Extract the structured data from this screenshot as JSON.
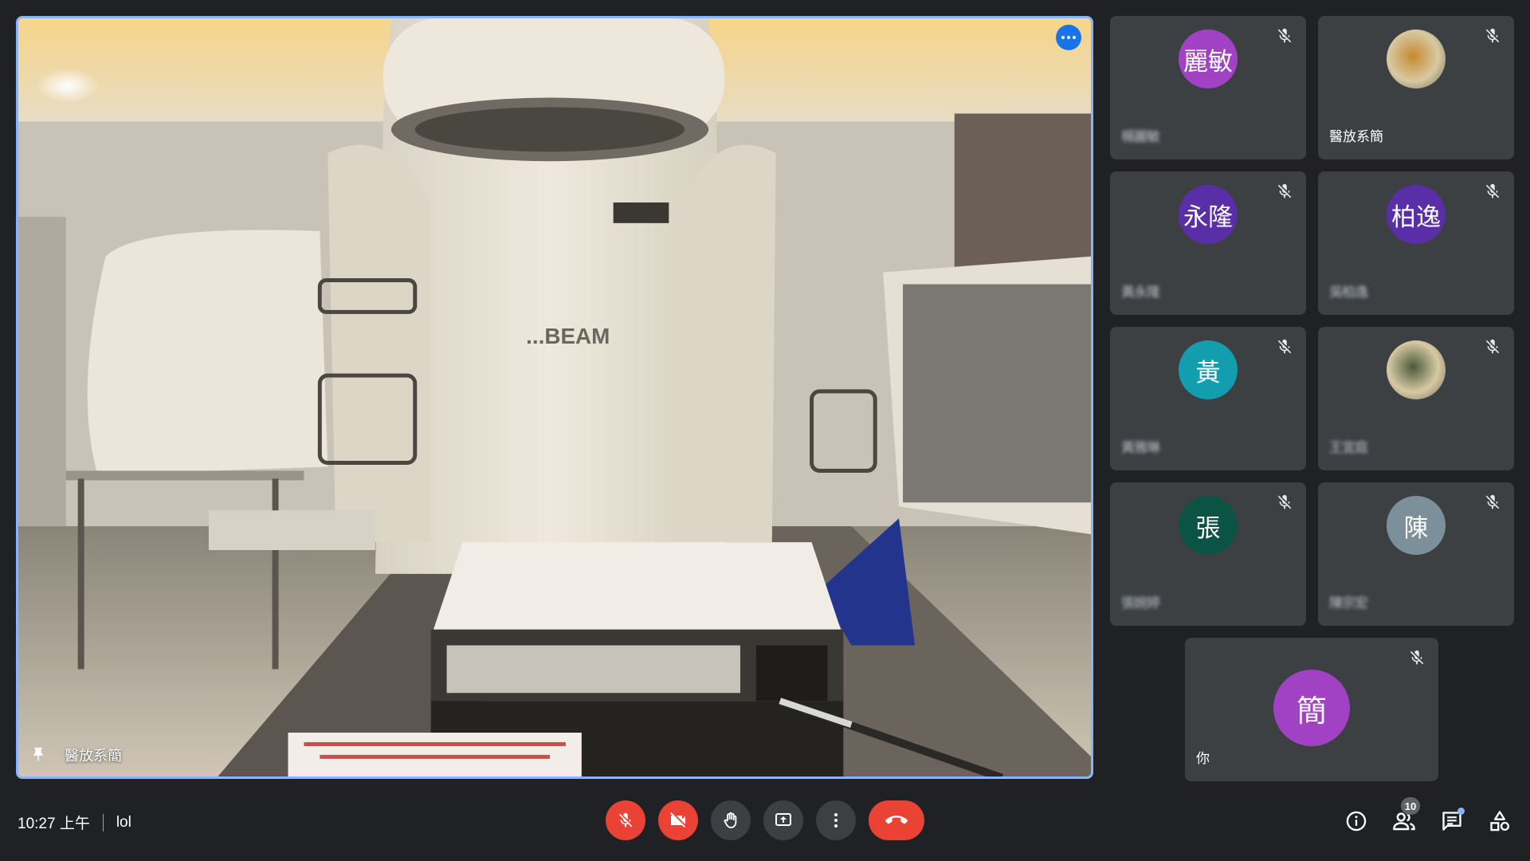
{
  "main_video": {
    "speaker_name": "醫放系簡",
    "machine_label": "...BEAM",
    "accent_border": "#8ab4f8"
  },
  "participants": [
    {
      "initials": "麗敏",
      "name": "楊麗敏",
      "name_blurred": true,
      "color": "#a142c4",
      "muted": true,
      "avatar_type": "initials"
    },
    {
      "initials": "",
      "name": "醫放系簡",
      "name_blurred": false,
      "color": "#c58a2e",
      "muted": true,
      "avatar_type": "photo"
    },
    {
      "initials": "永隆",
      "name": "黃永隆",
      "name_blurred": true,
      "color": "#5a2ea6",
      "muted": true,
      "avatar_type": "initials"
    },
    {
      "initials": "柏逸",
      "name": "吳柏逸",
      "name_blurred": true,
      "color": "#5a2ea6",
      "muted": true,
      "avatar_type": "initials"
    },
    {
      "initials": "黃",
      "name": "黃雅琳",
      "name_blurred": true,
      "color": "#129eaf",
      "muted": true,
      "avatar_type": "initials"
    },
    {
      "initials": "",
      "name": "王宜庭",
      "name_blurred": true,
      "color": "#4a5a3a",
      "muted": true,
      "avatar_type": "photo"
    },
    {
      "initials": "張",
      "name": "張婉婷",
      "name_blurred": true,
      "color": "#0b5345",
      "muted": true,
      "avatar_type": "initials"
    },
    {
      "initials": "陳",
      "name": "陳宗宏",
      "name_blurred": true,
      "color": "#7c909c",
      "muted": true,
      "avatar_type": "initials"
    }
  ],
  "self_tile": {
    "initials": "簡",
    "name": "你",
    "color": "#a142c4",
    "muted": true
  },
  "bottom_bar": {
    "time": "10:27 上午",
    "meeting_name": "lol",
    "participant_count": "10",
    "chat_has_new": true
  },
  "icons": {
    "more_options": "more-horiz-icon",
    "pin": "pin-icon",
    "mic_off": "mic-off-icon",
    "cam_off": "videocam-off-icon",
    "hand": "raise-hand-icon",
    "present": "present-screen-icon",
    "more": "more-vert-icon",
    "hangup": "call-end-icon",
    "info": "info-icon",
    "people": "people-icon",
    "chat": "chat-icon",
    "activities": "activities-icon"
  },
  "colors": {
    "background": "#202124",
    "tile": "#3c4043",
    "danger": "#ea4335",
    "accent": "#1a73e8"
  }
}
